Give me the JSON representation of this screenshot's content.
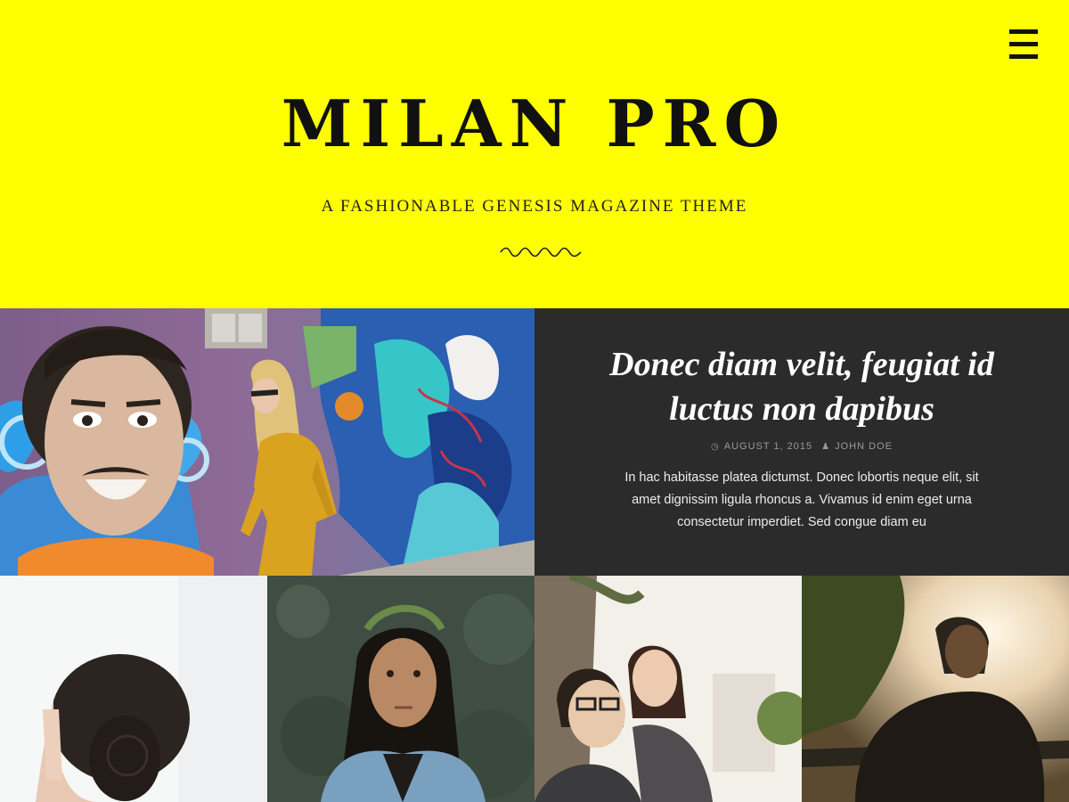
{
  "header": {
    "site_title": "MILAN PRO",
    "site_description": "A FASHIONABLE GENESIS MAGAZINE THEME",
    "menu_icon": "hamburger-menu-icon",
    "background": "#ffff00"
  },
  "featured": {
    "title": "Donec diam velit, feugiat id luctus non dapibus",
    "date": "AUGUST 1, 2015",
    "author": "JOHN DOE",
    "date_icon": "clock-icon",
    "author_icon": "user-icon",
    "excerpt": "In hac habitasse platea dictumst. Donec lobortis neque elit, sit amet dignissim ligula rhoncus a. Vivamus id enim eget urna consectetur imperdiet. Sed congue diam eu",
    "panel_background": "#2b2b2b"
  },
  "thumbnails": [
    {
      "icon": "woman-hair-bun-photo"
    },
    {
      "icon": "woman-leaf-crown-photo"
    },
    {
      "icon": "couple-piggyback-photo"
    },
    {
      "icon": "man-sunset-photo"
    }
  ]
}
